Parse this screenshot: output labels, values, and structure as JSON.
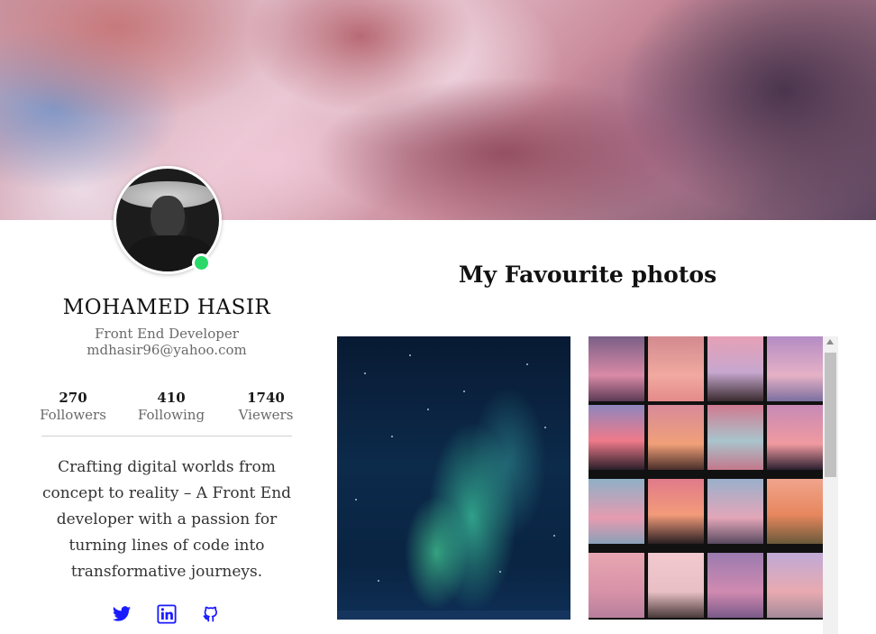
{
  "cover": {
    "image": "pink-cloudy-sky"
  },
  "profile": {
    "avatar": "profile-photo",
    "status_color": "#2bd96b",
    "name": "MOHAMED HASIR",
    "role": "Front End Developer",
    "email": "mdhasir96@yahoo.com",
    "stats": [
      {
        "value": "270",
        "label": "Followers"
      },
      {
        "value": "410",
        "label": "Following"
      },
      {
        "value": "1740",
        "label": "Viewers"
      }
    ],
    "bio": "Crafting digital worlds from concept to reality – A Front End developer with a passion for turning lines of code into transformative journeys.",
    "socials": [
      {
        "icon": "twitter-icon"
      },
      {
        "icon": "linkedin-icon"
      },
      {
        "icon": "github-icon"
      }
    ],
    "social_color": "#1a1aff"
  },
  "gallery": {
    "title": "My Favourite photos",
    "photos": [
      {
        "image": "aurora-night-sky"
      },
      {
        "image": "pink-sunset-collage"
      }
    ]
  }
}
